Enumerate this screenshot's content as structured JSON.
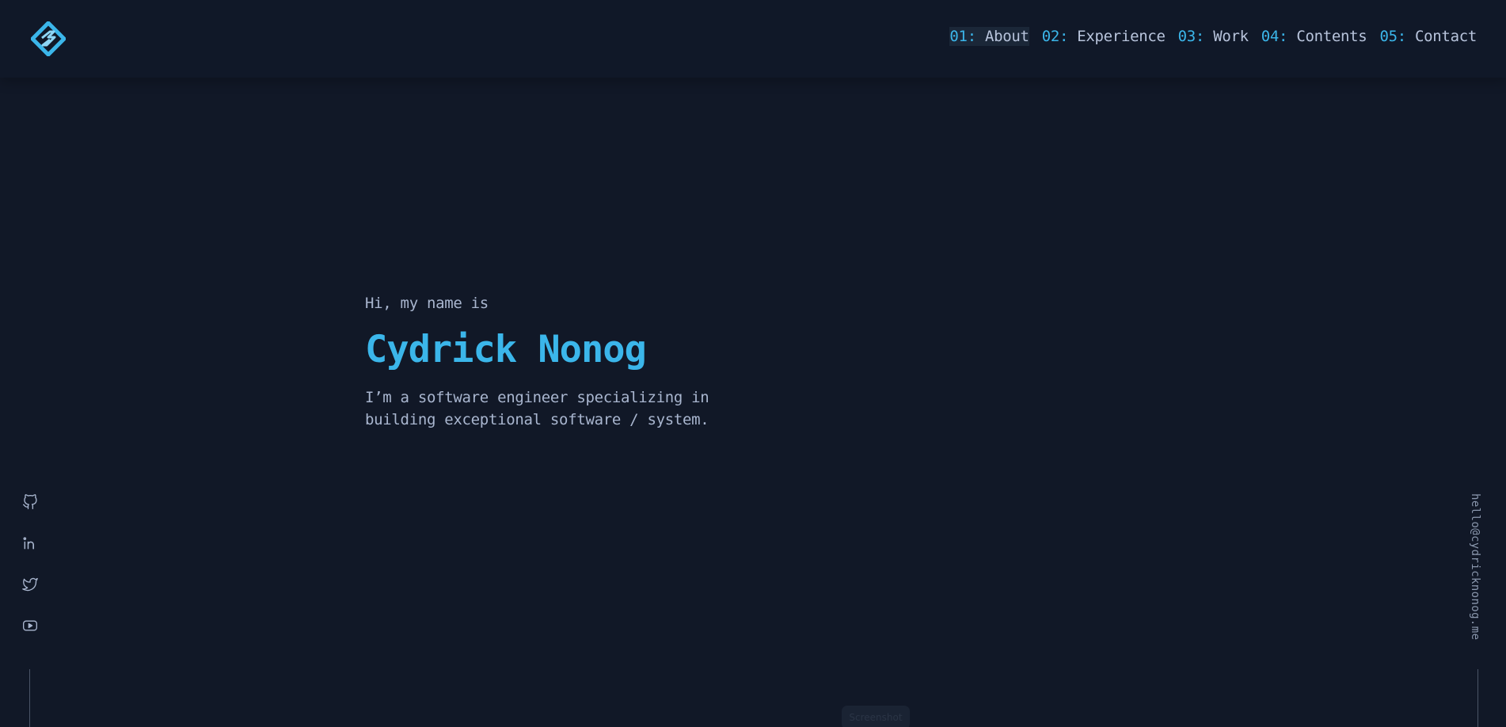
{
  "header": {
    "logo_icon": "diamond-logo-icon",
    "nav": [
      {
        "num": "01:",
        "label": "About"
      },
      {
        "num": "02:",
        "label": "Experience"
      },
      {
        "num": "03:",
        "label": "Work"
      },
      {
        "num": "04:",
        "label": "Contents"
      },
      {
        "num": "05:",
        "label": "Contact"
      }
    ]
  },
  "hero": {
    "greeting": "Hi, my name is",
    "name": "Cydrick Nonog",
    "tagline": "I’m a software engineer specializing in building exceptional software / system."
  },
  "social": [
    {
      "icon": "github-icon"
    },
    {
      "icon": "linkedin-icon"
    },
    {
      "icon": "twitter-icon"
    },
    {
      "icon": "youtube-icon"
    }
  ],
  "email": "hello@cydricknonog.me",
  "screenshot_button": "Screenshot",
  "colors": {
    "background": "#111827",
    "accent": "#3bb6ea",
    "text": "#a9b6cf"
  }
}
